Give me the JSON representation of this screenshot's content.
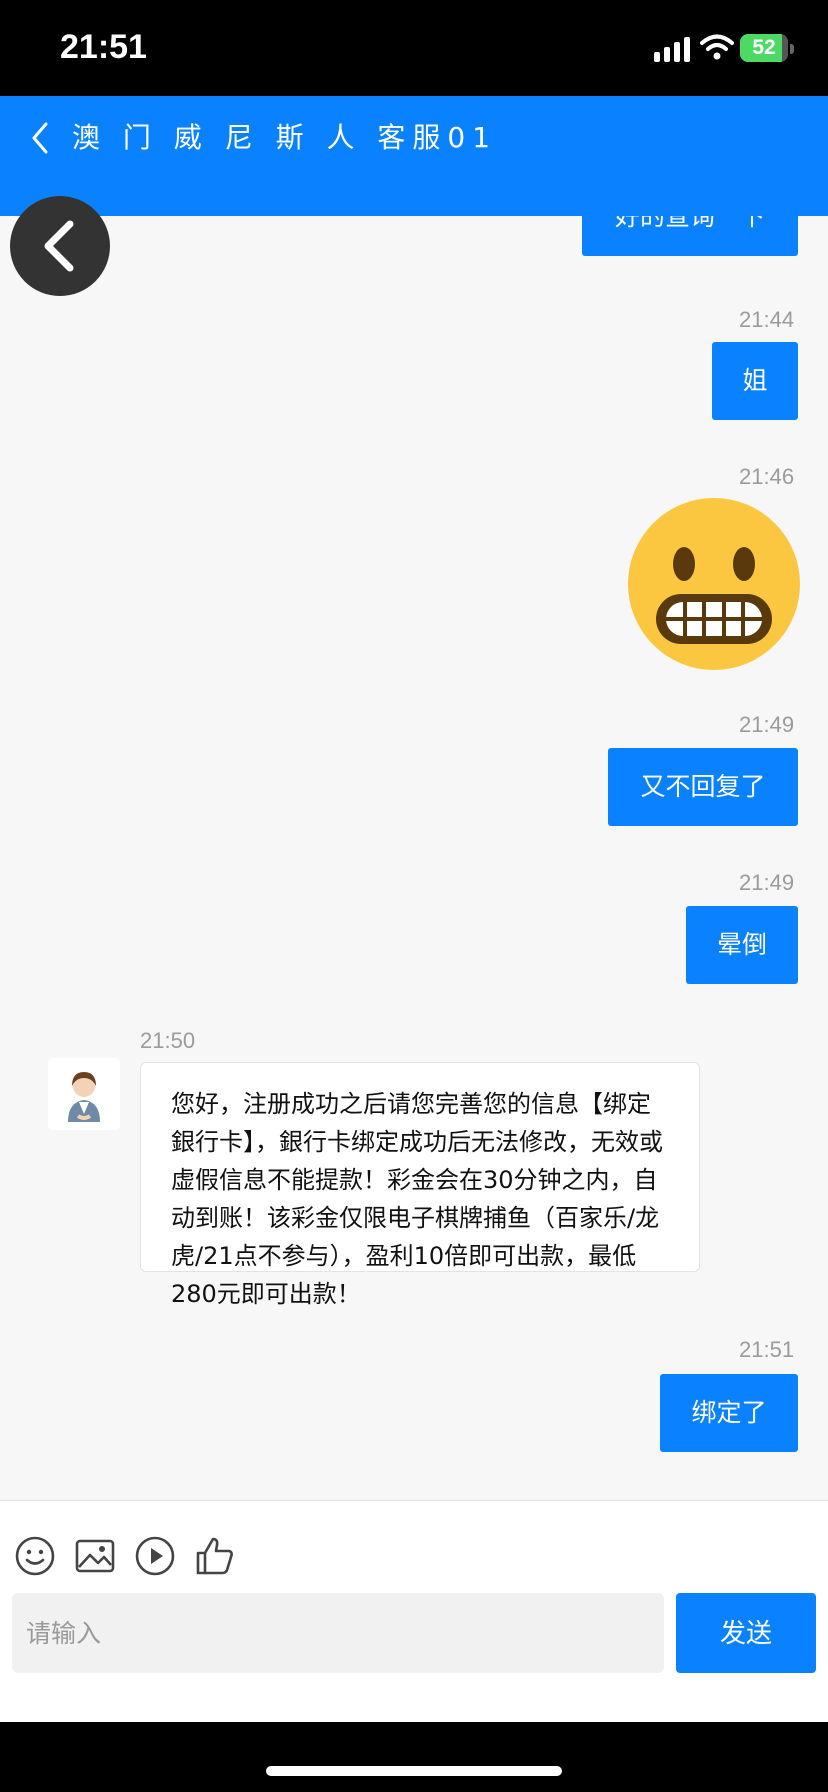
{
  "status_bar": {
    "time": "21:51",
    "battery": "52"
  },
  "header": {
    "title": "澳 门 威 尼 斯 人 客服01"
  },
  "messages": [
    {
      "side": "out",
      "text": "好的查询一下"
    },
    {
      "side": "out",
      "time": "21:44",
      "text": "姐"
    },
    {
      "side": "out",
      "time": "21:46",
      "emoji": "grimacing-face-emoji"
    },
    {
      "side": "out",
      "time": "21:49",
      "text": "又不回复了"
    },
    {
      "side": "out",
      "time": "21:49",
      "text": "晕倒"
    },
    {
      "side": "in",
      "time": "21:50",
      "text": "您好，注册成功之后请您完善您的信息【绑定銀行卡】，銀行卡绑定成功后无法修改，无效或虚假信息不能提款！彩金会在30分钟之内，自动到账！该彩金仅限电子棋牌捕鱼（百家乐/龙虎/21点不参与），盈利10倍即可出款，最低280元即可出款！"
    },
    {
      "side": "out",
      "time": "21:51",
      "text": "绑定了"
    }
  ],
  "composer": {
    "tools": [
      "emoji-icon",
      "image-icon",
      "video-icon",
      "thumbs-up-icon"
    ],
    "placeholder": "请输入",
    "send_label": "发送"
  },
  "colors": {
    "accent": "#0a82ff",
    "background": "#f7f7f7"
  }
}
